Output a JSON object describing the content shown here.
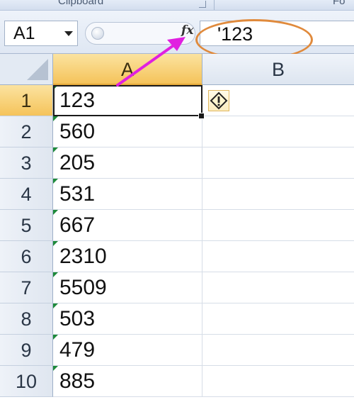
{
  "ribbon": {
    "group_label": "Clipboard",
    "next_group_label": "Fo"
  },
  "formula_bar": {
    "name_box": "A1",
    "fx_label": "fx",
    "formula_value": "'123"
  },
  "columns": [
    "A",
    "B"
  ],
  "rows": [
    {
      "num": "1",
      "a": "123"
    },
    {
      "num": "2",
      "a": "560"
    },
    {
      "num": "3",
      "a": "205"
    },
    {
      "num": "4",
      "a": "531"
    },
    {
      "num": "5",
      "a": "667"
    },
    {
      "num": "6",
      "a": "2310"
    },
    {
      "num": "7",
      "a": "5509"
    },
    {
      "num": "8",
      "a": "503"
    },
    {
      "num": "9",
      "a": "479"
    },
    {
      "num": "10",
      "a": "885"
    }
  ],
  "colors": {
    "selected_header": "#f5c35a",
    "annotation_circle": "#e08a3c",
    "annotation_arrow": "#e020e0",
    "error_indicator": "#1e8a3a"
  },
  "icons": {
    "error_button": "warning-diamond-icon",
    "name_box_dropdown": "chevron-down-icon"
  }
}
